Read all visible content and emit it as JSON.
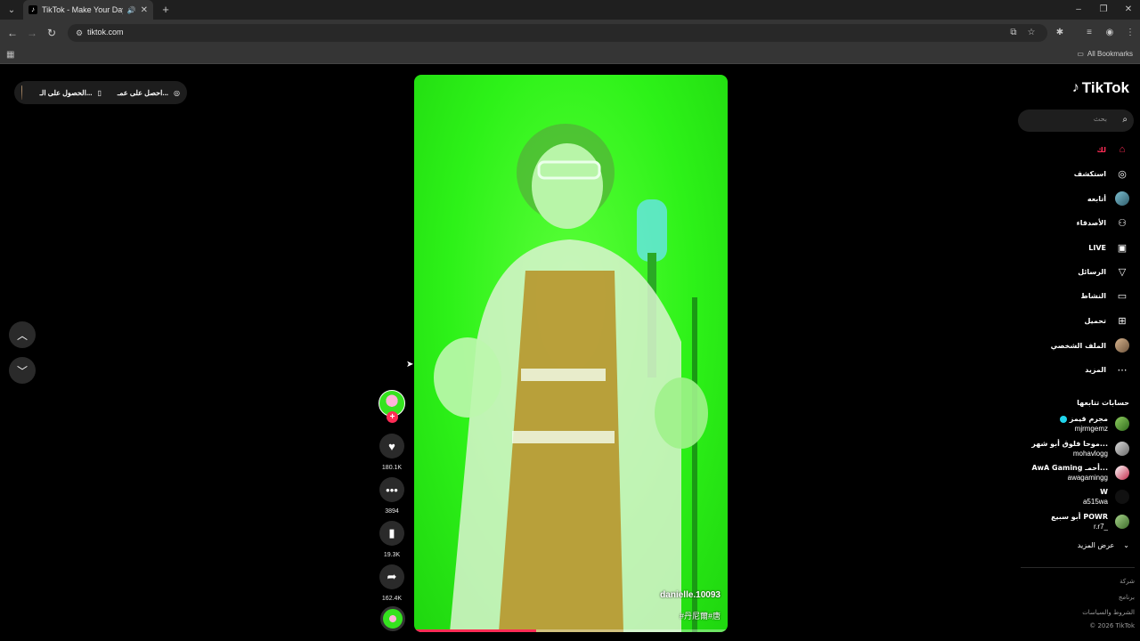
{
  "browser": {
    "tab_title": "TikTok - Make Your Day",
    "favicon": "tiktok-favicon",
    "url": "tiktok.com",
    "all_bookmarks": "All Bookmarks"
  },
  "top_pill": {
    "get_coins": "احصل على عمـ...",
    "get_app": "الحصول على الـ..."
  },
  "sidebar": {
    "logo": "TikTok",
    "search_placeholder": "بحث",
    "nav": [
      {
        "label": "لك",
        "icon": "home-icon",
        "active": true
      },
      {
        "label": "استكشف",
        "icon": "compass-icon"
      },
      {
        "label": "أتابعه",
        "icon": "following-avatar"
      },
      {
        "label": "الأصدقاء",
        "icon": "friends-icon"
      },
      {
        "label": "LIVE",
        "icon": "live-icon"
      },
      {
        "label": "الرسائل",
        "icon": "messages-icon"
      },
      {
        "label": "النشاط",
        "icon": "activity-icon"
      },
      {
        "label": "تحميل",
        "icon": "upload-icon"
      },
      {
        "label": "الملف الشخصي",
        "icon": "profile-avatar"
      },
      {
        "label": "المزيد",
        "icon": "more-icon"
      }
    ],
    "following_title": "حسابات تتابعها",
    "accounts": [
      {
        "name": "مجرم قيمز",
        "handle": "mjrmgemz",
        "verified": true
      },
      {
        "name": "موحا فلوق أبو شهر...",
        "handle": "mohavlogg"
      },
      {
        "name": "AwA Gaming أحمـ...",
        "handle": "awagamingg"
      },
      {
        "name": "W",
        "handle": "a515wa"
      },
      {
        "name": "أبو سبيع POWR",
        "handle": "r.r7_"
      }
    ],
    "see_more": "عرض المزيد",
    "footer": [
      "شركة",
      "برنامج",
      "الشروط والسياسات",
      "© 2026 TikTok"
    ]
  },
  "video": {
    "author": "danielle.10093",
    "tags": "#丹尼爾#唐",
    "progress": 0.39,
    "likes": "180.1K",
    "comments": "3894",
    "saves": "19.3K",
    "shares": "162.4K"
  }
}
